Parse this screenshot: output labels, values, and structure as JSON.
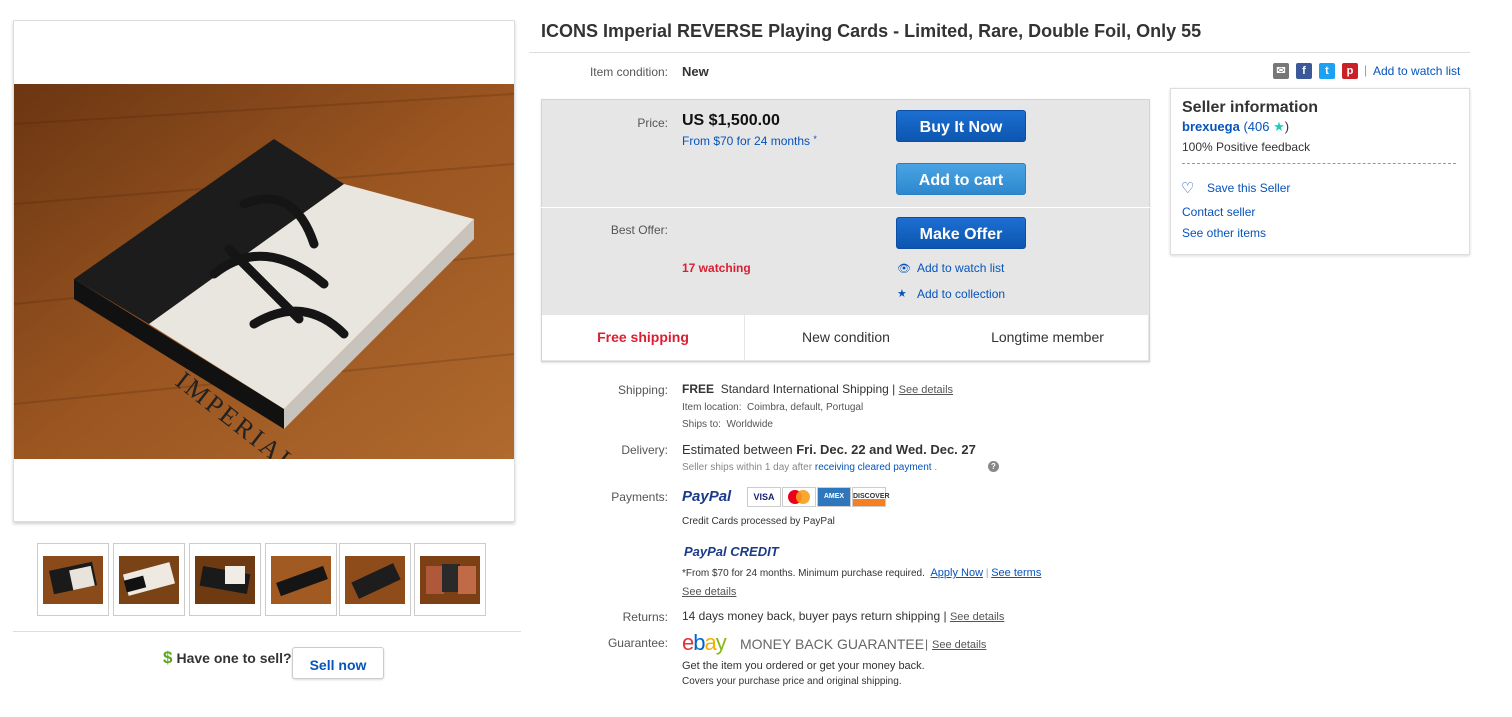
{
  "title": "ICONS Imperial REVERSE Playing Cards - Limited, Rare, Double Foil, Only 55",
  "condition": {
    "label": "Item condition:",
    "value": "New"
  },
  "share": {
    "watch_label": "Add to watch list",
    "separator": "|"
  },
  "price": {
    "label": "Price:",
    "value": "US $1,500.00",
    "financing": "From $70 for 24 months",
    "asterisk": "*"
  },
  "buttons": {
    "buy_now": "Buy It Now",
    "add_to_cart": "Add to cart",
    "make_offer": "Make Offer"
  },
  "best_offer": {
    "label": "Best Offer:"
  },
  "watching": "17 watching",
  "links": {
    "watch": "Add to watch list",
    "collection": "Add to collection"
  },
  "features": [
    "Free shipping",
    "New condition",
    "Longtime member"
  ],
  "seller": {
    "heading": "Seller information",
    "name": "brexuega",
    "score_open": "(406",
    "score_close": ")",
    "feedback": "100% Positive feedback",
    "save": "Save this Seller",
    "contact": "Contact seller",
    "other": "See other items"
  },
  "shipping": {
    "label": "Shipping:",
    "free": "FREE",
    "method": "Standard International Shipping |",
    "see": "See details",
    "location_label": "Item location:",
    "location": "Coimbra, default, Portugal",
    "ships_label": "Ships to:",
    "ships": "Worldwide"
  },
  "delivery": {
    "label": "Delivery:",
    "prefix": "Estimated between",
    "dates": "Fri. Dec. 22 and Wed. Dec. 27",
    "note_prefix": "Seller ships within 1 day after",
    "note_link": "receiving cleared payment",
    "note_suffix": "."
  },
  "payments": {
    "label": "Payments:",
    "paypal": "PayPal",
    "cards": [
      "VISA",
      "MasterCard",
      "AMEX",
      "DISCOVER"
    ],
    "processed": "Credit Cards processed by PayPal",
    "credit_title": "PayPal CREDIT",
    "credit_terms": "*From $70 for 24 months. Minimum purchase required.",
    "apply": "Apply Now",
    "see_terms": "See terms",
    "see_details": "See details"
  },
  "returns": {
    "label": "Returns:",
    "text": "14 days money back, buyer pays return shipping |",
    "see": "See details"
  },
  "guarantee": {
    "label": "Guarantee:",
    "ebay": [
      "e",
      "b",
      "a",
      "y"
    ],
    "mbg": "MONEY BACK GUARANTEE",
    "sep": "|",
    "see": "See details",
    "line1": "Get the item you ordered or get your money back.",
    "line2": "Covers your purchase price and original shipping."
  },
  "sell": {
    "prompt": "Have one to sell?",
    "dollar": "$",
    "button": "Sell now"
  },
  "main_photo_text": "IMPERIAL",
  "colors": {
    "accent_blue": "#0654ba",
    "buy_button": "#0c56b0",
    "cart_button": "#2d88cf",
    "watching_red": "#dd1e31",
    "wood": "#8a4a1a"
  }
}
